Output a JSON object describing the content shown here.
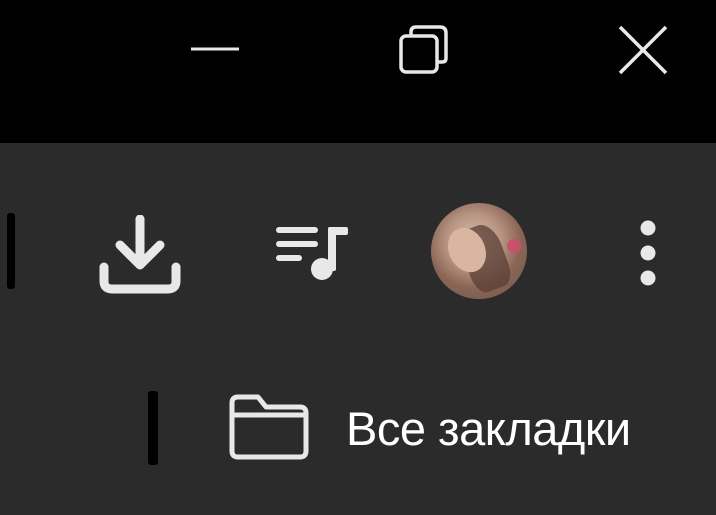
{
  "window_controls": {
    "minimize_icon": "minimize-icon",
    "maximize_icon": "restore-icon",
    "close_icon": "close-icon"
  },
  "toolbar": {
    "download_icon": "download-icon",
    "media_icon": "media-queue-icon",
    "avatar_icon": "profile-avatar",
    "menu_icon": "more-vertical-icon"
  },
  "bookmarks_bar": {
    "items": [
      {
        "label": "Все закладки",
        "icon": "folder-icon"
      }
    ]
  },
  "colors": {
    "titlebar_bg": "#000000",
    "toolbar_bg": "#2b2b2b",
    "icon": "#e8e8e8",
    "text": "#ffffff"
  }
}
